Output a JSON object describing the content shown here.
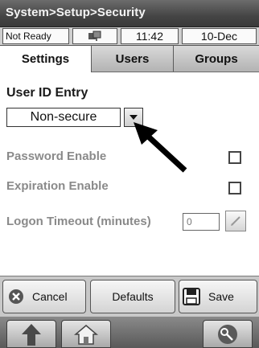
{
  "breadcrumb": "System>Setup>Security",
  "status": {
    "state": "Not Ready",
    "indicator_icon": "network-status-icon",
    "time": "11:42",
    "date": "10-Dec"
  },
  "tabs": [
    {
      "label": "Settings",
      "active": true
    },
    {
      "label": "Users",
      "active": false
    },
    {
      "label": "Groups",
      "active": false
    }
  ],
  "settings": {
    "user_id_entry_label": "User ID Entry",
    "user_id_entry_value": "Non-secure",
    "password_enable_label": "Password Enable",
    "password_enable_checked": false,
    "expiration_enable_label": "Expiration Enable",
    "expiration_enable_checked": false,
    "logon_timeout_label": "Logon Timeout (minutes)",
    "logon_timeout_value": "0"
  },
  "actions": {
    "cancel_label": "Cancel",
    "defaults_label": "Defaults",
    "save_label": "Save"
  },
  "nav": {
    "up_icon": "up-arrow-icon",
    "home_icon": "home-icon",
    "key_icon": "key-icon"
  },
  "colors": {
    "titlebar": "#454545",
    "disabled_text": "#8a8a8a"
  }
}
